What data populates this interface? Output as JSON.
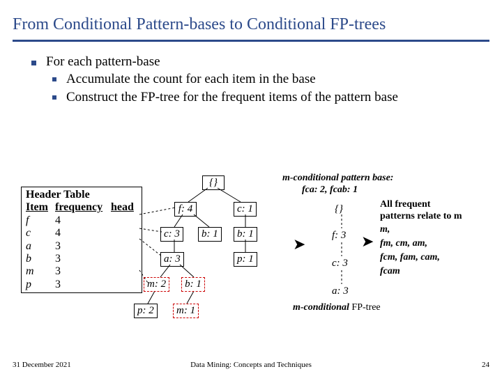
{
  "title": "From Conditional Pattern-bases to Conditional FP-trees",
  "bullets": {
    "l1": "For each pattern-base",
    "l2a": "Accumulate the count for each item in the base",
    "l2b": "Construct the FP-tree for the frequent items of the pattern base"
  },
  "header_table": {
    "title": "Header Table",
    "cols": {
      "c1": "Item",
      "c2": "frequency",
      "c3": "head"
    },
    "rows": [
      {
        "item": "f",
        "freq": "4"
      },
      {
        "item": "c",
        "freq": "4"
      },
      {
        "item": "a",
        "freq": "3"
      },
      {
        "item": "b",
        "freq": "3"
      },
      {
        "item": "m",
        "freq": "3"
      },
      {
        "item": "p",
        "freq": "3"
      }
    ]
  },
  "tree": {
    "root": "{}",
    "f4": "f: 4",
    "c1r": "c: 1",
    "c3": "c: 3",
    "b1a": "b: 1",
    "b1b": "b: 1",
    "a3": "a: 3",
    "p1": "p: 1",
    "m2": "m: 2",
    "b1c": "b: 1",
    "p2": "p: 2",
    "m1": "m: 1"
  },
  "right": {
    "pb_title": "m-conditional pattern base:",
    "pb_items": "fca: 2, fcab: 1",
    "allfreq1": "All frequent",
    "allfreq2": "patterns relate to m",
    "line_m": "m,",
    "line_fm": "fm, cm, am,",
    "line_fcm": "fcm, fam, cam,",
    "line_fcam": "fcam"
  },
  "smalltree": {
    "root": "{}",
    "f3": "f: 3",
    "c3": "c: 3",
    "a3": "a: 3"
  },
  "mcond_tree_label_bold": "m-conditional",
  "mcond_tree_label_rest": " FP-tree",
  "footer": {
    "date": "31 December 2021",
    "subtitle": "Data Mining: Concepts and Techniques",
    "pagenum": "24"
  }
}
